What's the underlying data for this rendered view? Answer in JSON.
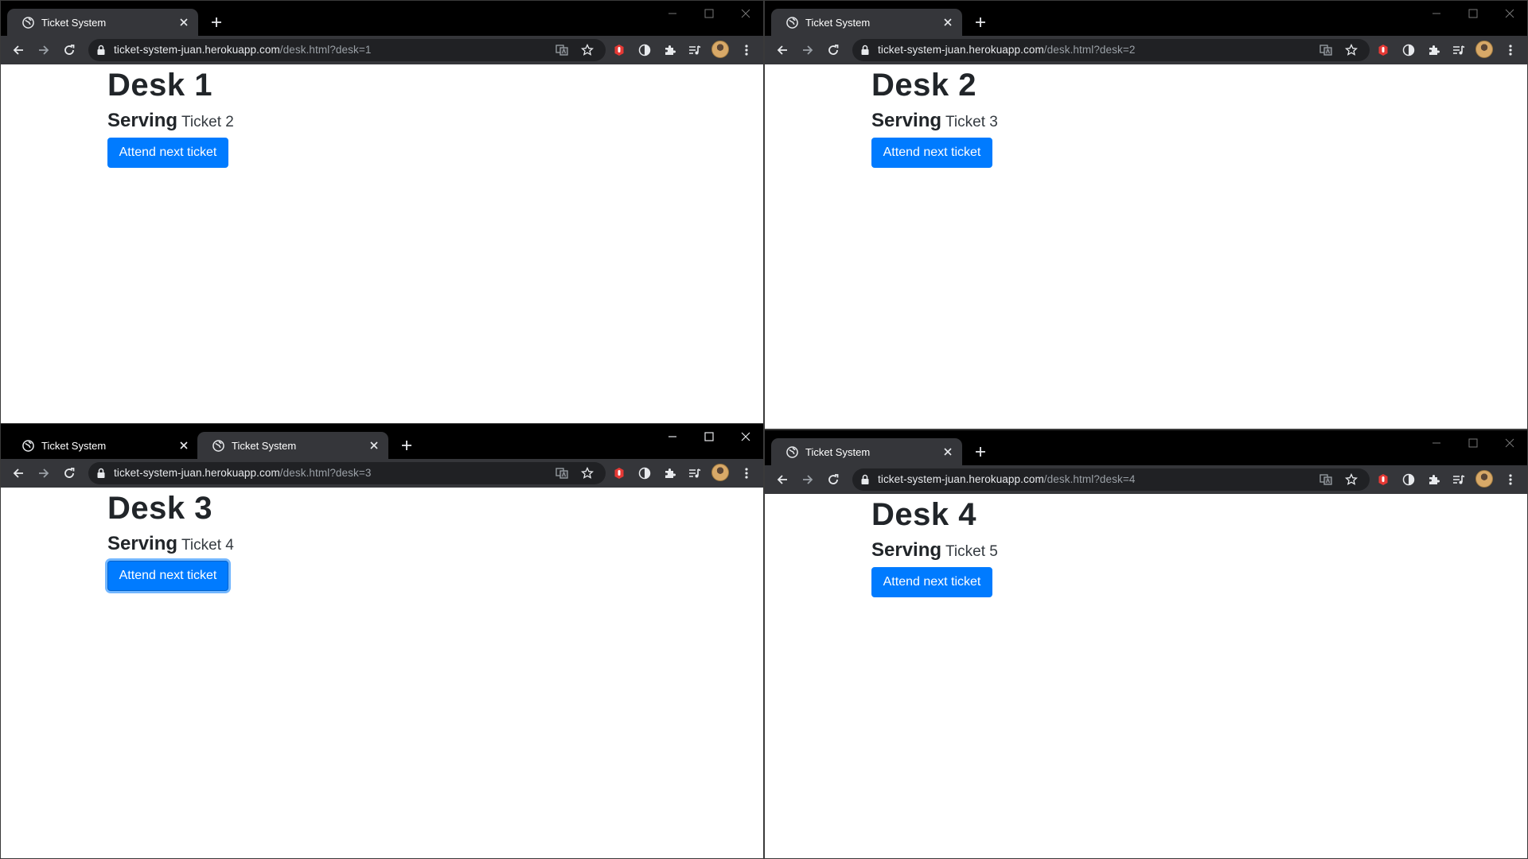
{
  "windows": [
    {
      "tabs": [
        {
          "title": "Ticket System",
          "active": true
        }
      ],
      "url_host": "ticket-system-juan.herokuapp.com",
      "url_path": "/desk.html?desk=1",
      "desk_title": "Desk 1",
      "serving_label": "Serving",
      "ticket": "Ticket 2",
      "button_label": "Attend next ticket",
      "button_focused": false
    },
    {
      "tabs": [
        {
          "title": "Ticket System",
          "active": true
        }
      ],
      "url_host": "ticket-system-juan.herokuapp.com",
      "url_path": "/desk.html?desk=2",
      "desk_title": "Desk 2",
      "serving_label": "Serving",
      "ticket": "Ticket 3",
      "button_label": "Attend next ticket",
      "button_focused": false
    },
    {
      "tabs": [
        {
          "title": "Ticket System",
          "active": false
        },
        {
          "title": "Ticket System",
          "active": true
        }
      ],
      "url_host": "ticket-system-juan.herokuapp.com",
      "url_path": "/desk.html?desk=3",
      "desk_title": "Desk 3",
      "serving_label": "Serving",
      "ticket": "Ticket 4",
      "button_label": "Attend next ticket",
      "button_focused": true
    },
    {
      "tabs": [
        {
          "title": "Ticket System",
          "active": true
        }
      ],
      "url_host": "ticket-system-juan.herokuapp.com",
      "url_path": "/desk.html?desk=4",
      "desk_title": "Desk 4",
      "serving_label": "Serving",
      "ticket": "Ticket 5",
      "button_label": "Attend next ticket",
      "button_focused": false
    }
  ],
  "colors": {
    "primary_button": "#007bff",
    "browser_frame": "#000000",
    "toolbar": "#35363a",
    "omnibox": "#202124"
  },
  "icons": {
    "favicon": "globe-icon",
    "tab_close": "close-icon",
    "new_tab": "plus-icon",
    "back": "back-arrow-icon",
    "forward": "forward-arrow-icon",
    "reload": "reload-icon",
    "lock": "lock-icon",
    "translate": "translate-icon",
    "bookmark": "star-icon",
    "extension_red": "stop-hand-icon",
    "extension_circle": "circle-half-icon",
    "extensions": "puzzle-icon",
    "media": "media-queue-icon",
    "profile": "avatar",
    "menu": "kebab-menu-icon"
  }
}
